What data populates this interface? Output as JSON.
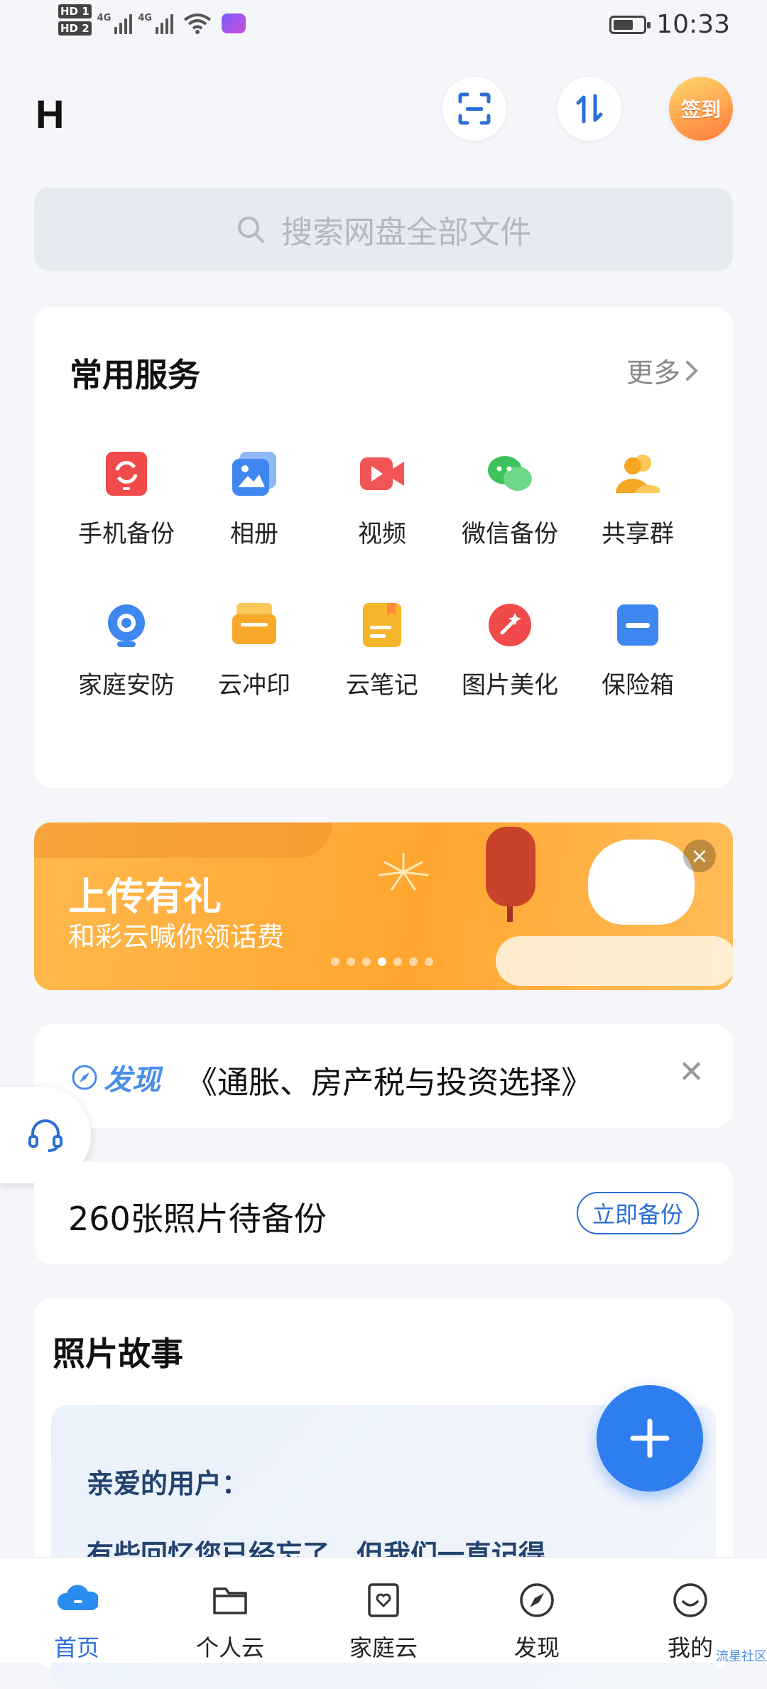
{
  "status_bar": {
    "sim1": "HD 1",
    "sim2": "HD 2",
    "net1": "4G",
    "net2": "4G",
    "time": "10:33",
    "battery_level": 0.7
  },
  "header": {
    "logo": "H",
    "checkin_label": "签到"
  },
  "search": {
    "placeholder": "搜索网盘全部文件"
  },
  "services": {
    "title": "常用服务",
    "more_label": "更多",
    "items": [
      {
        "label": "手机备份",
        "icon": "phone-backup-icon",
        "color": "#f04a4a"
      },
      {
        "label": "相册",
        "icon": "album-icon",
        "color": "#3e86f0"
      },
      {
        "label": "视频",
        "icon": "video-icon",
        "color": "#f25555"
      },
      {
        "label": "微信备份",
        "icon": "wechat-icon",
        "color": "#3dc25c"
      },
      {
        "label": "共享群",
        "icon": "share-group-icon",
        "color": "#f6a623"
      },
      {
        "label": "家庭安防",
        "icon": "camera-icon",
        "color": "#3e86f0"
      },
      {
        "label": "云冲印",
        "icon": "print-icon",
        "color": "#f7a92a"
      },
      {
        "label": "云笔记",
        "icon": "note-icon",
        "color": "#f6b62c"
      },
      {
        "label": "图片美化",
        "icon": "beautify-icon",
        "color": "#f04a4a"
      },
      {
        "label": "保险箱",
        "icon": "safe-icon",
        "color": "#3e86f0"
      }
    ]
  },
  "banner": {
    "title": "上传有礼",
    "subtitle": "和彩云喊你领话费",
    "slides": 7,
    "active_slide": 4
  },
  "discover": {
    "tag": "发现",
    "text": "《通胀、房产税与投资选择》"
  },
  "backup": {
    "text": "260张照片待备份",
    "button": "立即备份"
  },
  "story": {
    "title": "照片故事",
    "greeting": "亲爱的用户：",
    "line": "有些回忆您已经忘了，但我们一直记得"
  },
  "nav": {
    "items": [
      {
        "label": "首页",
        "icon": "cloud-home-icon",
        "active": true
      },
      {
        "label": "个人云",
        "icon": "folder-icon",
        "active": false
      },
      {
        "label": "家庭云",
        "icon": "family-cloud-icon",
        "active": false
      },
      {
        "label": "发现",
        "icon": "compass-icon",
        "active": false
      },
      {
        "label": "我的",
        "icon": "smile-icon",
        "active": false
      }
    ]
  },
  "watermark": "流星社区",
  "colors": {
    "accent": "#2b6fd6",
    "fab": "#2f7ef0",
    "banner": "#ffa62f"
  }
}
